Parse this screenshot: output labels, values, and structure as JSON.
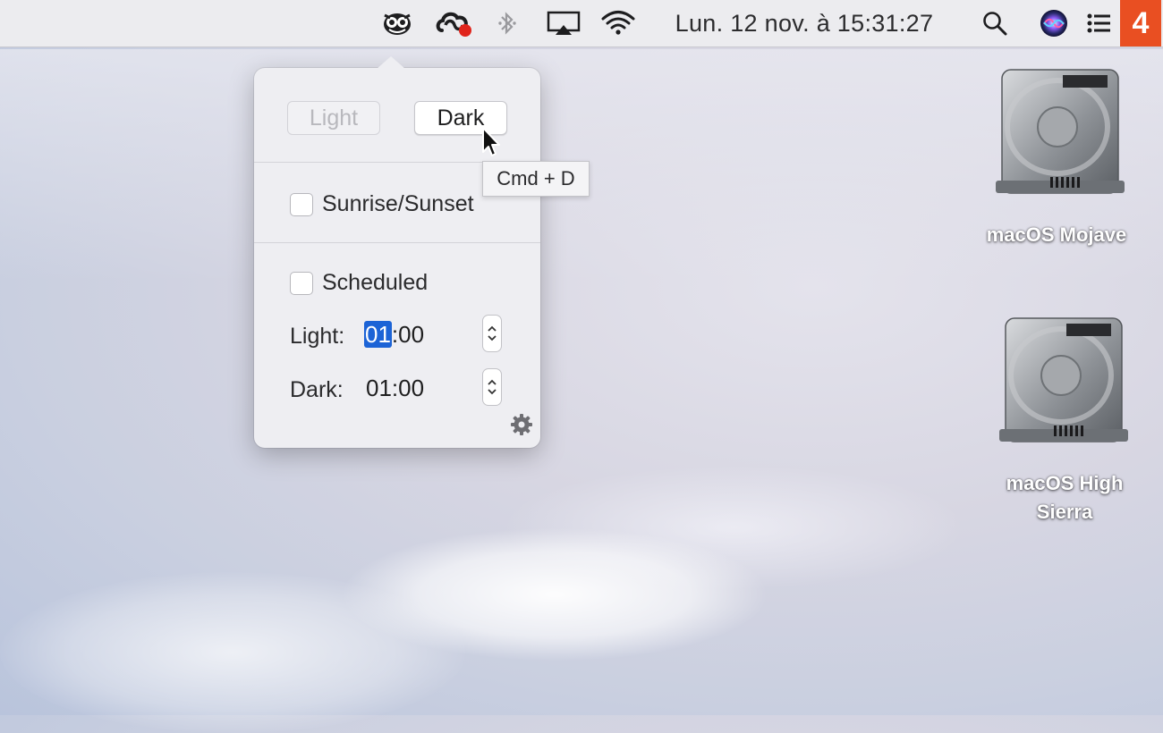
{
  "menubar": {
    "items": [
      {
        "icon": "night-owl-icon"
      },
      {
        "icon": "creative-cloud-icon"
      },
      {
        "icon": "bluetooth-icon"
      },
      {
        "icon": "airplay-icon"
      },
      {
        "icon": "wifi-icon"
      }
    ],
    "clock": "Lun. 12 nov. à  15:31:27",
    "right_icons": [
      "search-icon",
      "siri-icon",
      "notification-center-icon"
    ],
    "badge": "4"
  },
  "popover": {
    "mode_light_label": "Light",
    "mode_dark_label": "Dark",
    "sunrise_label": "Sunrise/Sunset",
    "sunrise_checked": false,
    "scheduled_label": "Scheduled",
    "scheduled_checked": false,
    "light_label": "Light:",
    "light_time_hour": "01",
    "light_time_rest": ":00",
    "dark_label": "Dark:",
    "dark_time": "01:00",
    "settings_icon": "gear-icon"
  },
  "tooltip": {
    "text": "Cmd + D"
  },
  "desktop": {
    "disks": [
      {
        "label": "macOS Mojave"
      },
      {
        "label_line1": "macOS High",
        "label_line2": "Sierra"
      }
    ]
  },
  "colors": {
    "accent": "#1c63d6",
    "badge": "#e94f22",
    "creative_cloud_dot": "#e0241b"
  }
}
